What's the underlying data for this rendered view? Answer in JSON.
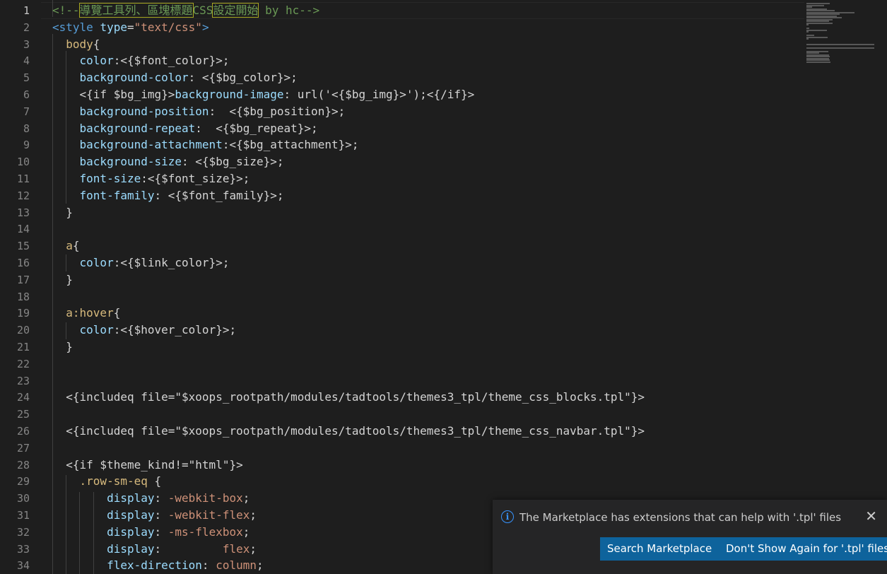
{
  "editor": {
    "active_line": 1,
    "lines": [
      {
        "n": "1",
        "tokens": [
          {
            "c": "tok-com",
            "t": "<!--"
          },
          {
            "c": "tok-com hl",
            "t": "導覽工具列、區塊標題"
          },
          {
            "c": "tok-com",
            "t": "CSS"
          },
          {
            "c": "tok-com hl",
            "t": "設定開始"
          },
          {
            "c": "tok-com",
            "t": " by hc-->"
          }
        ]
      },
      {
        "n": "2",
        "tokens": [
          {
            "c": "tok-tag",
            "t": "<style"
          },
          {
            "c": "tok-txt",
            "t": " "
          },
          {
            "c": "tok-attr",
            "t": "type"
          },
          {
            "c": "tok-txt",
            "t": "="
          },
          {
            "c": "tok-str",
            "t": "\"text/css\""
          },
          {
            "c": "tok-tag",
            "t": ">"
          }
        ]
      },
      {
        "n": "3",
        "tokens": [
          {
            "c": "tok-txt",
            "t": "  "
          },
          {
            "c": "tok-sel",
            "t": "body"
          },
          {
            "c": "tok-txt",
            "t": "{"
          }
        ]
      },
      {
        "n": "4",
        "tokens": [
          {
            "c": "tok-txt",
            "t": "    "
          },
          {
            "c": "tok-prop",
            "t": "color"
          },
          {
            "c": "tok-txt",
            "t": ":<{$font_color}>;"
          }
        ]
      },
      {
        "n": "5",
        "tokens": [
          {
            "c": "tok-txt",
            "t": "    "
          },
          {
            "c": "tok-prop",
            "t": "background-color"
          },
          {
            "c": "tok-txt",
            "t": ": <{$bg_color}>;"
          }
        ]
      },
      {
        "n": "6",
        "tokens": [
          {
            "c": "tok-txt",
            "t": "    <{if $bg_img}>"
          },
          {
            "c": "tok-prop",
            "t": "background-image"
          },
          {
            "c": "tok-txt",
            "t": ": url('<{$bg_img}>');<{/if}>"
          }
        ]
      },
      {
        "n": "7",
        "tokens": [
          {
            "c": "tok-txt",
            "t": "    "
          },
          {
            "c": "tok-prop",
            "t": "background-position"
          },
          {
            "c": "tok-txt",
            "t": ":  <{$bg_position}>;"
          }
        ]
      },
      {
        "n": "8",
        "tokens": [
          {
            "c": "tok-txt",
            "t": "    "
          },
          {
            "c": "tok-prop",
            "t": "background-repeat"
          },
          {
            "c": "tok-txt",
            "t": ":  <{$bg_repeat}>;"
          }
        ]
      },
      {
        "n": "9",
        "tokens": [
          {
            "c": "tok-txt",
            "t": "    "
          },
          {
            "c": "tok-prop",
            "t": "background-attachment"
          },
          {
            "c": "tok-txt",
            "t": ":<{$bg_attachment}>;"
          }
        ]
      },
      {
        "n": "10",
        "tokens": [
          {
            "c": "tok-txt",
            "t": "    "
          },
          {
            "c": "tok-prop",
            "t": "background-size"
          },
          {
            "c": "tok-txt",
            "t": ": <{$bg_size}>;"
          }
        ]
      },
      {
        "n": "11",
        "tokens": [
          {
            "c": "tok-txt",
            "t": "    "
          },
          {
            "c": "tok-prop",
            "t": "font-size"
          },
          {
            "c": "tok-txt",
            "t": ":<{$font_size}>;"
          }
        ]
      },
      {
        "n": "12",
        "tokens": [
          {
            "c": "tok-txt",
            "t": "    "
          },
          {
            "c": "tok-prop",
            "t": "font-family"
          },
          {
            "c": "tok-txt",
            "t": ": <{$font_family}>;"
          }
        ]
      },
      {
        "n": "13",
        "tokens": [
          {
            "c": "tok-txt",
            "t": "  }"
          }
        ]
      },
      {
        "n": "14",
        "tokens": []
      },
      {
        "n": "15",
        "tokens": [
          {
            "c": "tok-txt",
            "t": "  "
          },
          {
            "c": "tok-sel",
            "t": "a"
          },
          {
            "c": "tok-txt",
            "t": "{"
          }
        ]
      },
      {
        "n": "16",
        "tokens": [
          {
            "c": "tok-txt",
            "t": "    "
          },
          {
            "c": "tok-prop",
            "t": "color"
          },
          {
            "c": "tok-txt",
            "t": ":<{$link_color}>;"
          }
        ]
      },
      {
        "n": "17",
        "tokens": [
          {
            "c": "tok-txt",
            "t": "  }"
          }
        ]
      },
      {
        "n": "18",
        "tokens": []
      },
      {
        "n": "19",
        "tokens": [
          {
            "c": "tok-txt",
            "t": "  "
          },
          {
            "c": "tok-sel",
            "t": "a:hover"
          },
          {
            "c": "tok-txt",
            "t": "{"
          }
        ]
      },
      {
        "n": "20",
        "tokens": [
          {
            "c": "tok-txt",
            "t": "    "
          },
          {
            "c": "tok-prop",
            "t": "color"
          },
          {
            "c": "tok-txt",
            "t": ":<{$hover_color}>;"
          }
        ]
      },
      {
        "n": "21",
        "tokens": [
          {
            "c": "tok-txt",
            "t": "  }"
          }
        ]
      },
      {
        "n": "22",
        "tokens": []
      },
      {
        "n": "23",
        "tokens": []
      },
      {
        "n": "24",
        "tokens": [
          {
            "c": "tok-txt",
            "t": "  <{includeq file=\"$xoops_rootpath/modules/tadtools/themes3_tpl/theme_css_blocks.tpl\"}>"
          }
        ]
      },
      {
        "n": "25",
        "tokens": []
      },
      {
        "n": "26",
        "tokens": [
          {
            "c": "tok-txt",
            "t": "  <{includeq file=\"$xoops_rootpath/modules/tadtools/themes3_tpl/theme_css_navbar.tpl\"}>"
          }
        ]
      },
      {
        "n": "27",
        "tokens": []
      },
      {
        "n": "28",
        "tokens": [
          {
            "c": "tok-txt",
            "t": "  <{if $theme_kind!=\"html\"}>"
          }
        ]
      },
      {
        "n": "29",
        "tokens": [
          {
            "c": "tok-txt",
            "t": "    "
          },
          {
            "c": "tok-sel",
            "t": ".row-sm-eq"
          },
          {
            "c": "tok-txt",
            "t": " {"
          }
        ]
      },
      {
        "n": "30",
        "tokens": [
          {
            "c": "tok-txt",
            "t": "        "
          },
          {
            "c": "tok-prop",
            "t": "display"
          },
          {
            "c": "tok-txt",
            "t": ": "
          },
          {
            "c": "tok-str",
            "t": "-webkit-box"
          },
          {
            "c": "tok-txt",
            "t": ";"
          }
        ]
      },
      {
        "n": "31",
        "tokens": [
          {
            "c": "tok-txt",
            "t": "        "
          },
          {
            "c": "tok-prop",
            "t": "display"
          },
          {
            "c": "tok-txt",
            "t": ": "
          },
          {
            "c": "tok-str",
            "t": "-webkit-flex"
          },
          {
            "c": "tok-txt",
            "t": ";"
          }
        ]
      },
      {
        "n": "32",
        "tokens": [
          {
            "c": "tok-txt",
            "t": "        "
          },
          {
            "c": "tok-prop",
            "t": "display"
          },
          {
            "c": "tok-txt",
            "t": ": "
          },
          {
            "c": "tok-str",
            "t": "-ms-flexbox"
          },
          {
            "c": "tok-txt",
            "t": ";"
          }
        ]
      },
      {
        "n": "33",
        "tokens": [
          {
            "c": "tok-txt",
            "t": "        "
          },
          {
            "c": "tok-prop",
            "t": "display"
          },
          {
            "c": "tok-txt",
            "t": ":         "
          },
          {
            "c": "tok-str",
            "t": "flex"
          },
          {
            "c": "tok-txt",
            "t": ";"
          }
        ]
      },
      {
        "n": "34",
        "tokens": [
          {
            "c": "tok-txt",
            "t": "        "
          },
          {
            "c": "tok-prop",
            "t": "flex-direction"
          },
          {
            "c": "tok-txt",
            "t": ": "
          },
          {
            "c": "tok-str",
            "t": "column"
          },
          {
            "c": "tok-txt",
            "t": ";"
          }
        ]
      }
    ]
  },
  "notification": {
    "icon": "info-icon",
    "message": "The Marketplace has extensions that can help with '.tpl' files",
    "close_icon": "close-icon",
    "close_glyph": "✕",
    "search_button": "Search Marketplace",
    "dont_show_button": "Don't Show Again for '.tpl' files"
  }
}
